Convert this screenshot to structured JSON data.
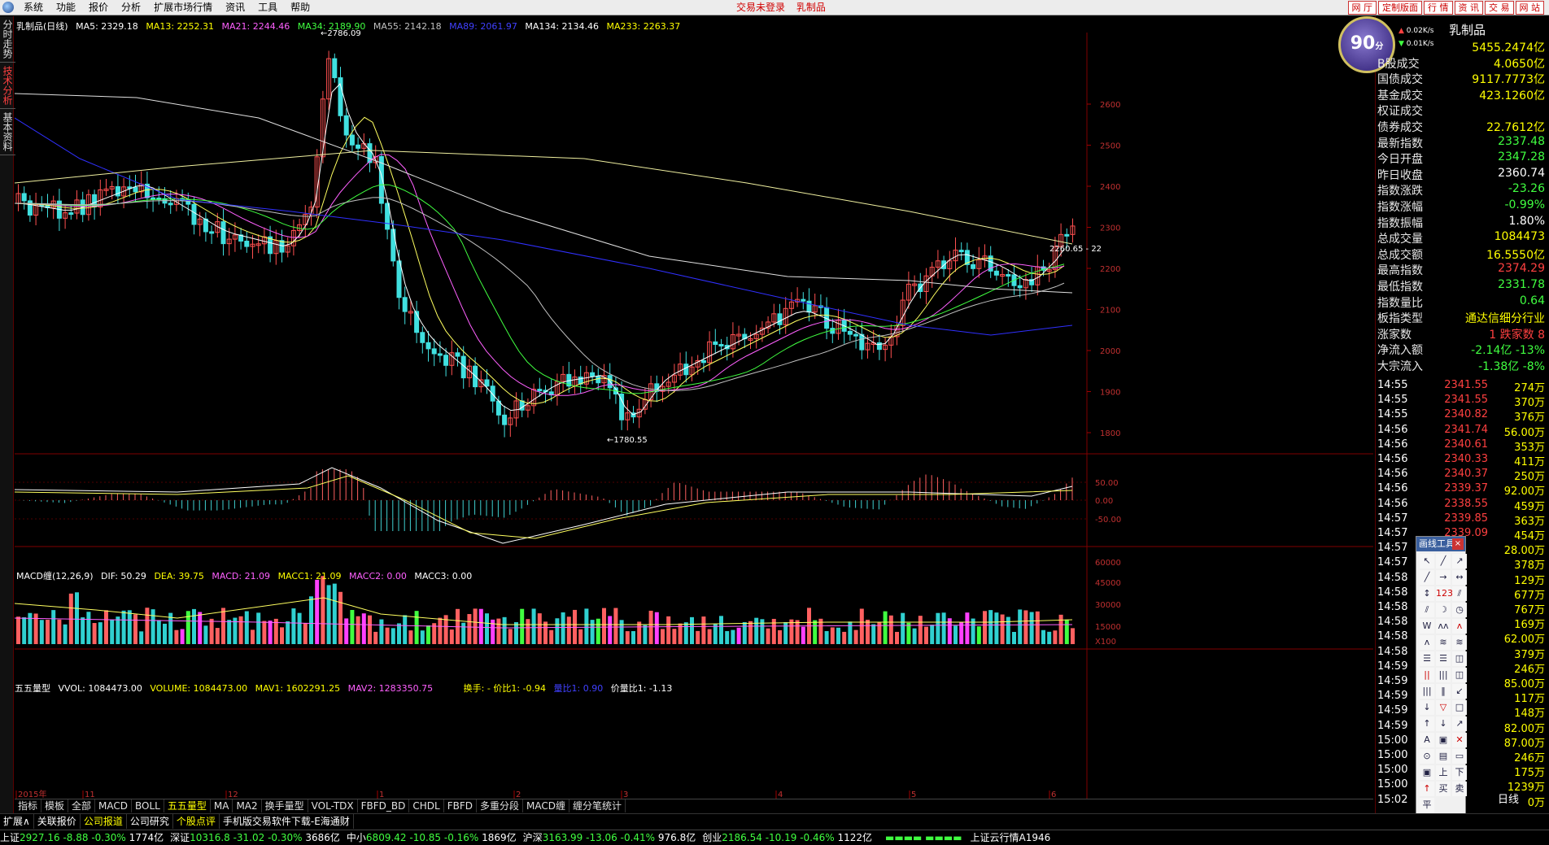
{
  "menubar": {
    "items": [
      "系统",
      "功能",
      "报价",
      "分析",
      "扩展市场行情",
      "资讯",
      "工具",
      "帮助"
    ],
    "status_left": "交易未登录",
    "status_right": "乳制品",
    "buttons": [
      "网 厅",
      "定制版面",
      "行 情",
      "资 讯",
      "交 易",
      "网 站"
    ]
  },
  "left_tabs": [
    "分时走势",
    "技术分析",
    "基本资料"
  ],
  "chart_header": {
    "title": "乳制品(日线)",
    "ma": [
      "MA5: 2329.18",
      "MA13: 2252.31",
      "MA21: 2244.46",
      "MA34: 2189.90",
      "MA55: 2142.18",
      "MA89: 2061.97",
      "MA134: 2134.46",
      "MA233: 2263.37"
    ],
    "high_label": "2786.09",
    "low_label": "1780.55",
    "right_label": "2260.65 - 22"
  },
  "price_axis": [
    "2600",
    "2500",
    "2400",
    "2300",
    "2200",
    "2100",
    "2000",
    "1900",
    "1800"
  ],
  "macd_header": [
    "MACD缠(12,26,9)",
    "DIF: 50.29",
    "DEA: 39.75",
    "MACD: 21.09",
    "MACC1: 21.09",
    "MACC2: 0.00",
    "MACC3: 0.00"
  ],
  "macd_axis": [
    "50.00",
    "0.00",
    "-50.00"
  ],
  "vol_header": [
    "五五量型",
    "VVOL: 1084473.00",
    "VOLUME: 1084473.00",
    "MAV1: 1602291.25",
    "MAV2: 1283350.75",
    "换手: - 价比1: -0.94",
    "量比1: 0.90",
    "价量比1: -1.13"
  ],
  "vol_axis": [
    "60000",
    "45000",
    "30000",
    "15000",
    "X100"
  ],
  "date_axis": [
    "2015年",
    "11",
    "12",
    "1",
    "2",
    "3",
    "4",
    "5",
    "6"
  ],
  "right_panel": {
    "score": "90",
    "score_unit": "分",
    "speed_up": "0.02K/s",
    "speed_down": "0.01K/s",
    "sector": "乳制品",
    "quotes": [
      {
        "label": "",
        "value": "5455.2474亿",
        "color": "#ffff00"
      },
      {
        "label": "B股成交",
        "value": "4.0650亿",
        "color": "#ffff00"
      },
      {
        "label": "国债成交",
        "value": "9117.7773亿",
        "color": "#ffff00"
      },
      {
        "label": "基金成交",
        "value": "423.1260亿",
        "color": "#ffff00"
      },
      {
        "label": "权证成交",
        "value": "",
        "color": "#ffff00"
      },
      {
        "label": "债券成交",
        "value": "22.7612亿",
        "color": "#ffff00"
      },
      {
        "label": "最新指数",
        "value": "2337.48",
        "color": "#40ff40"
      },
      {
        "label": "今日开盘",
        "value": "2347.28",
        "color": "#40ff40"
      },
      {
        "label": "昨日收盘",
        "value": "2360.74",
        "color": "#ffffff"
      },
      {
        "label": "指数涨跌",
        "value": "-23.26",
        "color": "#40ff40"
      },
      {
        "label": "指数涨幅",
        "value": "-0.99%",
        "color": "#40ff40"
      },
      {
        "label": "指数振幅",
        "value": "1.80%",
        "color": "#ffffff"
      },
      {
        "label": "总成交量",
        "value": "1084473",
        "color": "#ffff00"
      },
      {
        "label": "总成交额",
        "value": "16.5550亿",
        "color": "#ffff00"
      },
      {
        "label": "最高指数",
        "value": "2374.29",
        "color": "#ff4040"
      },
      {
        "label": "最低指数",
        "value": "2331.78",
        "color": "#40ff40"
      },
      {
        "label": "指数量比",
        "value": "0.64",
        "color": "#40ff40"
      },
      {
        "label": "板指类型",
        "value": "通达信细分行业",
        "color": "#ffff00"
      },
      {
        "label": "涨家数",
        "value": "1 跌家数 8",
        "color": "#ff4040"
      },
      {
        "label": "净流入额",
        "value": "-2.14亿 -13%",
        "color": "#40ff40"
      },
      {
        "label": "大宗流入",
        "value": "-1.38亿 -8%",
        "color": "#40ff40"
      }
    ],
    "ticks": [
      {
        "t": "14:55",
        "p": "2341.55",
        "v": "274万"
      },
      {
        "t": "14:55",
        "p": "2341.55",
        "v": "370万"
      },
      {
        "t": "14:55",
        "p": "2340.82",
        "v": "376万"
      },
      {
        "t": "14:56",
        "p": "2341.74",
        "v": "56.00万"
      },
      {
        "t": "14:56",
        "p": "2340.61",
        "v": "353万"
      },
      {
        "t": "14:56",
        "p": "2340.33",
        "v": "411万"
      },
      {
        "t": "14:56",
        "p": "2340.37",
        "v": "250万"
      },
      {
        "t": "14:56",
        "p": "2339.37",
        "v": "92.00万"
      },
      {
        "t": "14:56",
        "p": "2338.55",
        "v": "459万"
      },
      {
        "t": "14:57",
        "p": "2339.85",
        "v": "363万"
      },
      {
        "t": "14:57",
        "p": "2339.09",
        "v": "454万"
      },
      {
        "t": "14:57",
        "p": "",
        "v": "28.00万"
      },
      {
        "t": "14:57",
        "p": "",
        "v": "378万"
      },
      {
        "t": "14:58",
        "p": "",
        "v": "129万"
      },
      {
        "t": "14:58",
        "p": "",
        "v": "677万"
      },
      {
        "t": "14:58",
        "p": "",
        "v": "767万"
      },
      {
        "t": "14:58",
        "p": "",
        "v": "169万"
      },
      {
        "t": "14:58",
        "p": "",
        "v": "62.00万"
      },
      {
        "t": "14:58",
        "p": "",
        "v": "379万"
      },
      {
        "t": "14:59",
        "p": "",
        "v": "246万"
      },
      {
        "t": "14:59",
        "p": "",
        "v": "85.00万"
      },
      {
        "t": "14:59",
        "p": "",
        "v": "117万"
      },
      {
        "t": "14:59",
        "p": "",
        "v": "148万"
      },
      {
        "t": "14:59",
        "p": "",
        "v": "82.00万"
      },
      {
        "t": "15:00",
        "p": "",
        "v": "87.00万"
      },
      {
        "t": "15:00",
        "p": "",
        "v": "246万"
      },
      {
        "t": "15:00",
        "p": "",
        "v": "175万"
      },
      {
        "t": "15:00",
        "p": "",
        "v": "1239万"
      },
      {
        "t": "15:02",
        "p": "",
        "v": "0万"
      }
    ],
    "period_label": "日线"
  },
  "draw_tool": {
    "title": "画线工具",
    "close": "×",
    "cells": [
      "↖",
      "╱",
      "↗",
      "╱",
      "→",
      "↔",
      "↕",
      "123",
      "⫽",
      "⫽",
      "☽",
      "◷",
      "W",
      "ʌʌ",
      "ʌ",
      "ʌ",
      "≋",
      "≋",
      "☰",
      "☰",
      "◫",
      "||",
      "|||",
      "◫",
      "|||",
      "‖",
      "↙",
      "↓",
      "▽",
      "□",
      "↑",
      "↓",
      "↗",
      "A",
      "▣",
      "✕",
      "⊙",
      "▤",
      "▭",
      "▣",
      "上",
      "下",
      "↑",
      "买",
      "卖",
      "平"
    ]
  },
  "bottom_tabs": [
    "指标",
    "模板",
    "全部",
    "MACD",
    "BOLL",
    "五五量型",
    "MA",
    "MA2",
    "换手量型",
    "VOL-TDX",
    "FBFD_BD",
    "CHDL",
    "FBFD",
    "多重分段",
    "MACD缠",
    "缠分笔统计"
  ],
  "bottom_active": "五五量型",
  "links": [
    {
      "label": "扩展∧",
      "alt": false
    },
    {
      "label": "关联报价",
      "alt": false
    },
    {
      "label": "公司报道",
      "alt": true
    },
    {
      "label": "公司研究",
      "alt": false
    },
    {
      "label": "个股点评",
      "alt": true
    },
    {
      "label": "手机版交易软件下载-E海通财",
      "alt": false
    }
  ],
  "status_indices": [
    {
      "name": "上证",
      "value": "2927.16",
      "chg": "-8.88",
      "pct": "-0.30%",
      "amt": "1774亿"
    },
    {
      "name": "深证",
      "value": "10316.8",
      "chg": "-31.02",
      "pct": "-0.30%",
      "amt": "3686亿"
    },
    {
      "name": "中小",
      "value": "6809.42",
      "chg": "-10.85",
      "pct": "-0.16%",
      "amt": "1869亿"
    },
    {
      "name": "沪深",
      "value": "3163.99",
      "chg": "-13.06",
      "pct": "-0.41%",
      "amt": "976.8亿"
    },
    {
      "name": "创业",
      "value": "2186.54",
      "chg": "-10.19",
      "pct": "-0.46%",
      "amt": "1122亿"
    }
  ],
  "status_msg": "上证云行情A1946"
}
